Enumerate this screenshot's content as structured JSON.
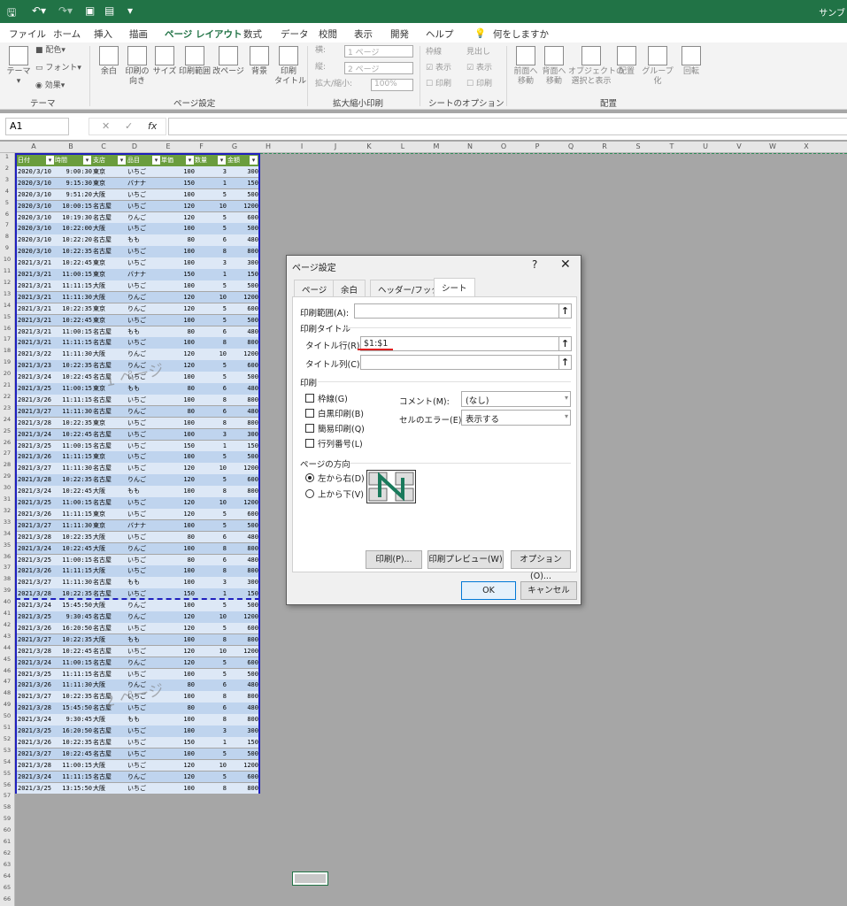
{
  "titlebar": {
    "title": "サンブ"
  },
  "tabs": [
    "ファイル",
    "ホーム",
    "挿入",
    "描画",
    "ページ レイアウト",
    "数式",
    "データ",
    "校閲",
    "表示",
    "開発",
    "ヘルプ"
  ],
  "tell_me": "何をしますか",
  "ribbon": {
    "theme": {
      "theme_btn": "テーマ",
      "colors": "配色",
      "fonts": "フォント",
      "effects": "効果",
      "group": "テーマ"
    },
    "page_setup": {
      "margins": "余白",
      "orientation": "印刷の\n向き",
      "size": "サイズ",
      "print_area": "印刷範囲",
      "breaks": "改ページ",
      "background": "背景",
      "print_titles": "印刷\nタイトル",
      "group": "ページ設定"
    },
    "scale": {
      "width_lbl": "横:",
      "width_val": "1 ページ",
      "height_lbl": "縦:",
      "height_val": "2 ページ",
      "scale_lbl": "拡大/縮小:",
      "scale_val": "100%",
      "group": "拡大縮小印刷"
    },
    "sheet_opts": {
      "gridlines": "枠線",
      "headings": "見出し",
      "view": "表示",
      "print": "印刷",
      "group": "シートのオプション"
    },
    "arrange": {
      "forward": "前面へ\n移動",
      "backward": "背面へ\n移動",
      "selection": "オブジェクトの\n選択と表示",
      "align": "配置",
      "group_btn": "グループ化",
      "rotate": "回転",
      "group": "配置"
    }
  },
  "formula_bar": {
    "namebox": "A1",
    "fx": "fx"
  },
  "columns": [
    "A",
    "B",
    "C",
    "D",
    "E",
    "F",
    "G",
    "H",
    "I",
    "J",
    "K",
    "L",
    "M",
    "N",
    "O",
    "P",
    "Q",
    "R",
    "S",
    "T",
    "U",
    "V",
    "W",
    "X"
  ],
  "table": {
    "headers": [
      "日付",
      "時間",
      "支店",
      "品目",
      "単価",
      "数量",
      "金額"
    ],
    "rows": [
      [
        "2020/3/10",
        "9:00:30",
        "東京",
        "いちご",
        "100",
        "3",
        "300"
      ],
      [
        "2020/3/10",
        "9:15:30",
        "東京",
        "バナナ",
        "150",
        "1",
        "150"
      ],
      [
        "2020/3/10",
        "9:51:20",
        "大阪",
        "いちご",
        "100",
        "5",
        "500"
      ],
      [
        "2020/3/10",
        "10:00:15",
        "名古屋",
        "いちご",
        "120",
        "10",
        "1200"
      ],
      [
        "2020/3/10",
        "10:19:30",
        "名古屋",
        "りんご",
        "120",
        "5",
        "600"
      ],
      [
        "2020/3/10",
        "10:22:00",
        "大阪",
        "いちご",
        "100",
        "5",
        "500"
      ],
      [
        "2020/3/10",
        "10:22:20",
        "名古屋",
        "もも",
        "80",
        "6",
        "480"
      ],
      [
        "2020/3/10",
        "10:22:35",
        "名古屋",
        "いちご",
        "100",
        "8",
        "800"
      ],
      [
        "2021/3/21",
        "10:22:45",
        "東京",
        "いちご",
        "100",
        "3",
        "300"
      ],
      [
        "2021/3/21",
        "11:00:15",
        "東京",
        "バナナ",
        "150",
        "1",
        "150"
      ],
      [
        "2021/3/21",
        "11:11:15",
        "大阪",
        "いちご",
        "100",
        "5",
        "500"
      ],
      [
        "2021/3/21",
        "11:11:30",
        "大阪",
        "りんご",
        "120",
        "10",
        "1200"
      ],
      [
        "2021/3/21",
        "10:22:35",
        "東京",
        "りんご",
        "120",
        "5",
        "600"
      ],
      [
        "2021/3/21",
        "10:22:45",
        "東京",
        "いちご",
        "100",
        "5",
        "500"
      ],
      [
        "2021/3/21",
        "11:00:15",
        "名古屋",
        "もも",
        "80",
        "6",
        "480"
      ],
      [
        "2021/3/21",
        "11:11:15",
        "名古屋",
        "いちご",
        "100",
        "8",
        "800"
      ],
      [
        "2021/3/22",
        "11:11:30",
        "大阪",
        "りんご",
        "120",
        "10",
        "1200"
      ],
      [
        "2021/3/23",
        "10:22:35",
        "名古屋",
        "りんご",
        "120",
        "5",
        "600"
      ],
      [
        "2021/3/24",
        "10:22:45",
        "名古屋",
        "いちご",
        "100",
        "5",
        "500"
      ],
      [
        "2021/3/25",
        "11:00:15",
        "東京",
        "もも",
        "80",
        "6",
        "480"
      ],
      [
        "2021/3/26",
        "11:11:15",
        "名古屋",
        "いちご",
        "100",
        "8",
        "800"
      ],
      [
        "2021/3/27",
        "11:11:30",
        "名古屋",
        "りんご",
        "80",
        "6",
        "480"
      ],
      [
        "2021/3/28",
        "10:22:35",
        "東京",
        "いちご",
        "100",
        "8",
        "800"
      ],
      [
        "2021/3/24",
        "10:22:45",
        "名古屋",
        "いちご",
        "100",
        "3",
        "300"
      ],
      [
        "2021/3/25",
        "11:00:15",
        "名古屋",
        "いちご",
        "150",
        "1",
        "150"
      ],
      [
        "2021/3/26",
        "11:11:15",
        "東京",
        "いちご",
        "100",
        "5",
        "500"
      ],
      [
        "2021/3/27",
        "11:11:30",
        "名古屋",
        "いちご",
        "120",
        "10",
        "1200"
      ],
      [
        "2021/3/28",
        "10:22:35",
        "名古屋",
        "りんご",
        "120",
        "5",
        "600"
      ],
      [
        "2021/3/24",
        "10:22:45",
        "大阪",
        "もも",
        "100",
        "8",
        "800"
      ],
      [
        "2021/3/25",
        "11:00:15",
        "名古屋",
        "いちご",
        "120",
        "10",
        "1200"
      ],
      [
        "2021/3/26",
        "11:11:15",
        "東京",
        "いちご",
        "120",
        "5",
        "600"
      ],
      [
        "2021/3/27",
        "11:11:30",
        "東京",
        "バナナ",
        "100",
        "5",
        "500"
      ],
      [
        "2021/3/28",
        "10:22:35",
        "大阪",
        "いちご",
        "80",
        "6",
        "480"
      ],
      [
        "2021/3/24",
        "10:22:45",
        "大阪",
        "りんご",
        "100",
        "8",
        "800"
      ],
      [
        "2021/3/25",
        "11:00:15",
        "名古屋",
        "いちご",
        "80",
        "6",
        "480"
      ],
      [
        "2021/3/26",
        "11:11:15",
        "大阪",
        "いちご",
        "100",
        "8",
        "800"
      ],
      [
        "2021/3/27",
        "11:11:30",
        "名古屋",
        "もも",
        "100",
        "3",
        "300"
      ],
      [
        "2021/3/28",
        "10:22:35",
        "名古屋",
        "いちご",
        "150",
        "1",
        "150"
      ],
      [
        "2021/3/24",
        "15:45:50",
        "大阪",
        "りんご",
        "100",
        "5",
        "500"
      ],
      [
        "2021/3/25",
        "9:30:45",
        "名古屋",
        "りんご",
        "120",
        "10",
        "1200"
      ],
      [
        "2021/3/26",
        "16:20:50",
        "名古屋",
        "いちご",
        "120",
        "5",
        "600"
      ],
      [
        "2021/3/27",
        "10:22:35",
        "大阪",
        "もも",
        "100",
        "8",
        "800"
      ],
      [
        "2021/3/28",
        "10:22:45",
        "名古屋",
        "いちご",
        "120",
        "10",
        "1200"
      ],
      [
        "2021/3/24",
        "11:00:15",
        "名古屋",
        "りんご",
        "120",
        "5",
        "600"
      ],
      [
        "2021/3/25",
        "11:11:15",
        "名古屋",
        "いちご",
        "100",
        "5",
        "500"
      ],
      [
        "2021/3/26",
        "11:11:30",
        "大阪",
        "りんご",
        "80",
        "6",
        "480"
      ],
      [
        "2021/3/27",
        "10:22:35",
        "名古屋",
        "いちご",
        "100",
        "8",
        "800"
      ],
      [
        "2021/3/28",
        "15:45:50",
        "名古屋",
        "いちご",
        "80",
        "6",
        "480"
      ],
      [
        "2021/3/24",
        "9:30:45",
        "大阪",
        "もも",
        "100",
        "8",
        "800"
      ],
      [
        "2021/3/25",
        "16:20:50",
        "名古屋",
        "いちご",
        "100",
        "3",
        "300"
      ],
      [
        "2021/3/26",
        "10:22:35",
        "名古屋",
        "いちご",
        "150",
        "1",
        "150"
      ],
      [
        "2021/3/27",
        "10:22:45",
        "名古屋",
        "いちご",
        "100",
        "5",
        "500"
      ],
      [
        "2021/3/28",
        "11:00:15",
        "大阪",
        "いちご",
        "120",
        "10",
        "1200"
      ],
      [
        "2021/3/24",
        "11:11:15",
        "名古屋",
        "りんご",
        "120",
        "5",
        "600"
      ],
      [
        "2021/3/25",
        "13:15:50",
        "大阪",
        "いちご",
        "100",
        "8",
        "800"
      ]
    ]
  },
  "watermark": "ページ",
  "dialog": {
    "title": "ページ設定",
    "help": "?",
    "close": "✕",
    "tabs": [
      "ページ",
      "余白",
      "ヘッダー/フッター",
      "シート"
    ],
    "print_area_label": "印刷範囲(A):",
    "print_area_value": "",
    "print_titles_heading": "印刷タイトル",
    "title_rows_label": "タイトル行(R):",
    "title_rows_value": "$1:$1",
    "title_cols_label": "タイトル列(C):",
    "title_cols_value": "",
    "print_heading": "印刷",
    "gridlines": "枠線(G)",
    "bw": "白黒印刷(B)",
    "draft": "簡易印刷(Q)",
    "headings": "行列番号(L)",
    "comments_label": "コメント(M):",
    "comments_value": "(なし)",
    "errors_label": "セルのエラー(E):",
    "errors_value": "表示する",
    "order_heading": "ページの方向",
    "order_ltr": "左から右(D)",
    "order_ttb": "上から下(V)",
    "print_btn": "印刷(P)...",
    "preview_btn": "印刷プレビュー(W)",
    "options_btn": "オプション(O)...",
    "ok": "OK",
    "cancel": "キャンセル"
  },
  "colors": {
    "excel_green": "#217346",
    "table_header": "#6a9d3d",
    "row_light": "#dde8f6",
    "row_dark": "#bfd4ee",
    "page_border": "#1f1fbf"
  }
}
